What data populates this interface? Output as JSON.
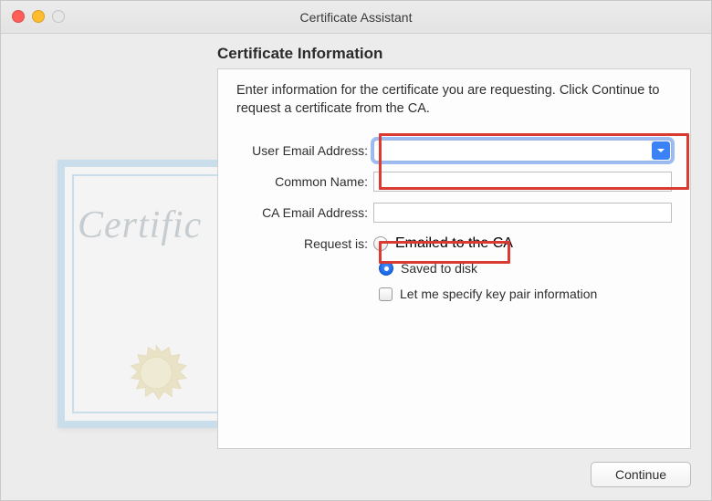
{
  "window": {
    "title": "Certificate Assistant"
  },
  "heading": "Certificate Information",
  "description": "Enter information for the certificate you are requesting. Click Continue to request a certificate from the CA.",
  "fields": {
    "user_email": {
      "label": "User Email Address:",
      "value": ""
    },
    "common_name": {
      "label": "Common Name:",
      "value": ""
    },
    "ca_email": {
      "label": "CA Email Address:",
      "value": ""
    },
    "request_is": {
      "label": "Request is:"
    }
  },
  "options": {
    "emailed": "Emailed to the CA",
    "saved": "Saved to disk",
    "specify_keypair": "Let me specify key pair information"
  },
  "selected_request": "saved",
  "buttons": {
    "continue": "Continue"
  },
  "illustration": {
    "script_text": "Certific"
  }
}
